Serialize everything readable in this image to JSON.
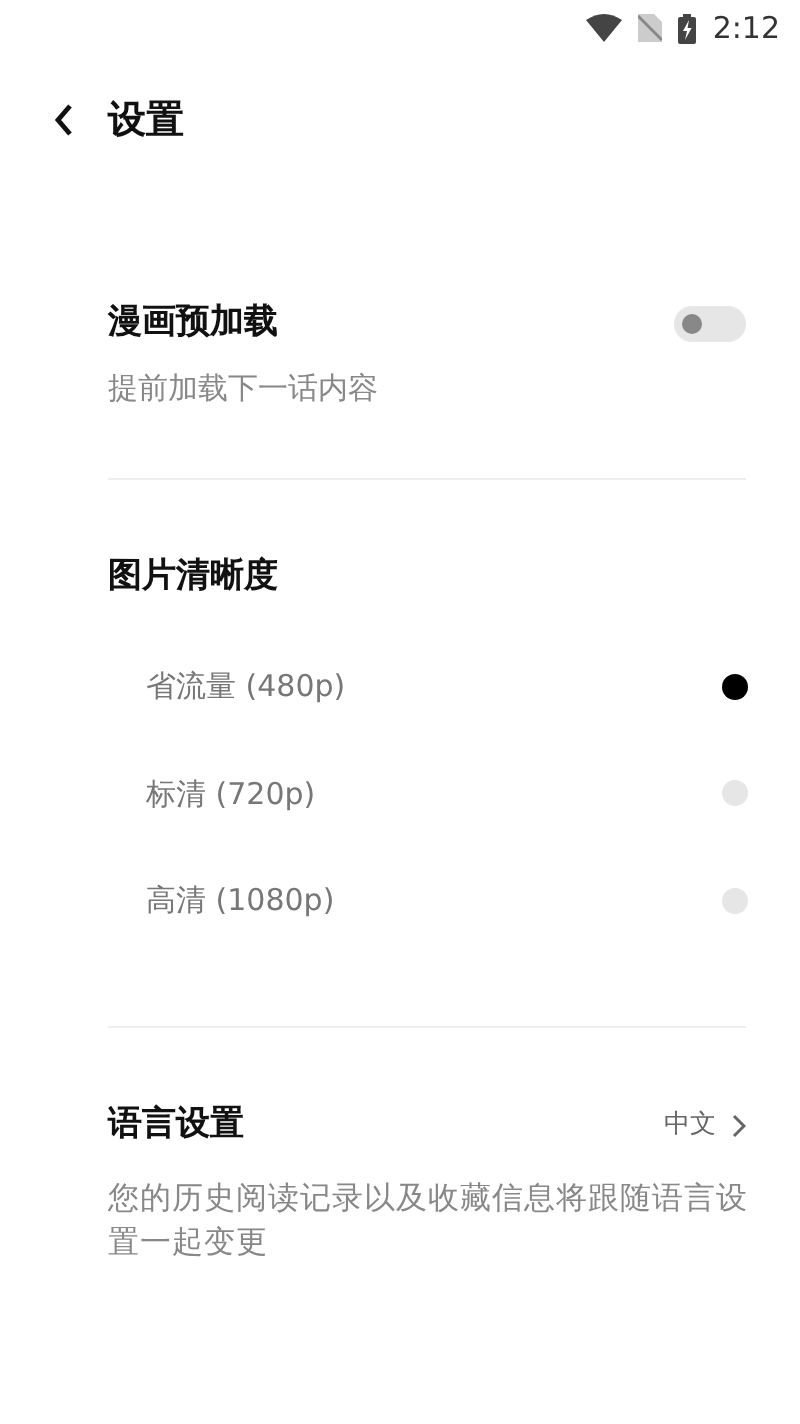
{
  "status_bar": {
    "time": "2:12"
  },
  "header": {
    "title": "设置"
  },
  "preload": {
    "title": "漫画预加载",
    "subtitle": "提前加载下一话内容",
    "on": false
  },
  "quality": {
    "title": "图片清晰度",
    "options": [
      {
        "label": "省流量 (480p)",
        "selected": true
      },
      {
        "label": "标清 (720p)",
        "selected": false
      },
      {
        "label": "高清 (1080p)",
        "selected": false
      }
    ]
  },
  "language": {
    "title": "语言设置",
    "value": "中文",
    "description": "您的历史阅读记录以及收藏信息将跟随语言设置一起变更"
  }
}
